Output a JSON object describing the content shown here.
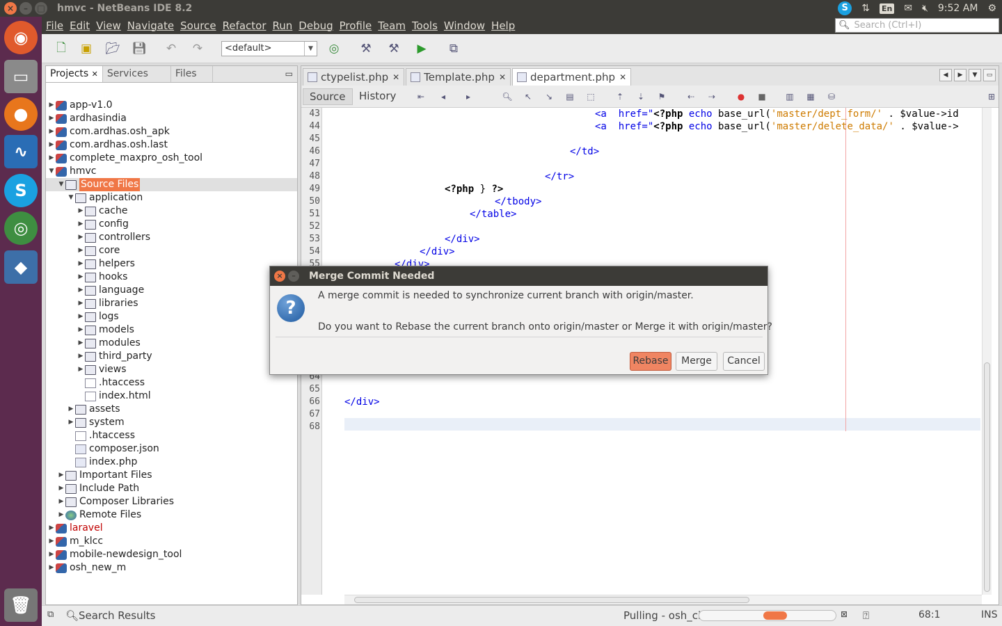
{
  "window": {
    "title": "hmvc - NetBeans IDE 8.2"
  },
  "tray": {
    "skype": "S",
    "lang": "En",
    "time": "9:52 AM"
  },
  "menu": [
    "File",
    "Edit",
    "View",
    "Navigate",
    "Source",
    "Refactor",
    "Run",
    "Debug",
    "Profile",
    "Team",
    "Tools",
    "Window",
    "Help"
  ],
  "search": {
    "placeholder": "Search (Ctrl+I)"
  },
  "toolbar": {
    "config": "<default>"
  },
  "panel_tabs": [
    "Projects",
    "Services",
    "Files"
  ],
  "tree": [
    {
      "label": "app-v1.0",
      "level": 0,
      "arrow": "▶",
      "icon": "proj"
    },
    {
      "label": "ardhasindia",
      "level": 0,
      "arrow": "▶",
      "icon": "proj"
    },
    {
      "label": "com.ardhas.osh_apk",
      "level": 0,
      "arrow": "▶",
      "icon": "proj"
    },
    {
      "label": "com.ardhas.osh.last",
      "level": 0,
      "arrow": "▶",
      "icon": "proj"
    },
    {
      "label": "complete_maxpro_osh_tool",
      "level": 0,
      "arrow": "▶",
      "icon": "proj"
    },
    {
      "label": "hmvc",
      "level": 0,
      "arrow": "▼",
      "icon": "proj"
    },
    {
      "label": "Source Files",
      "level": 1,
      "arrow": "▼",
      "icon": "fold",
      "selected": true
    },
    {
      "label": "application",
      "level": 2,
      "arrow": "▼",
      "icon": "fold"
    },
    {
      "label": "cache",
      "level": 3,
      "arrow": "▶",
      "icon": "fold"
    },
    {
      "label": "config",
      "level": 3,
      "arrow": "▶",
      "icon": "fold"
    },
    {
      "label": "controllers",
      "level": 3,
      "arrow": "▶",
      "icon": "fold"
    },
    {
      "label": "core",
      "level": 3,
      "arrow": "▶",
      "icon": "fold"
    },
    {
      "label": "helpers",
      "level": 3,
      "arrow": "▶",
      "icon": "fold"
    },
    {
      "label": "hooks",
      "level": 3,
      "arrow": "▶",
      "icon": "fold"
    },
    {
      "label": "language",
      "level": 3,
      "arrow": "▶",
      "icon": "fold"
    },
    {
      "label": "libraries",
      "level": 3,
      "arrow": "▶",
      "icon": "fold"
    },
    {
      "label": "logs",
      "level": 3,
      "arrow": "▶",
      "icon": "fold"
    },
    {
      "label": "models",
      "level": 3,
      "arrow": "▶",
      "icon": "fold"
    },
    {
      "label": "modules",
      "level": 3,
      "arrow": "▶",
      "icon": "fold"
    },
    {
      "label": "third_party",
      "level": 3,
      "arrow": "▶",
      "icon": "fold"
    },
    {
      "label": "views",
      "level": 3,
      "arrow": "▶",
      "icon": "fold"
    },
    {
      "label": ".htaccess",
      "level": 3,
      "arrow": "",
      "icon": "file"
    },
    {
      "label": "index.html",
      "level": 3,
      "arrow": "",
      "icon": "file"
    },
    {
      "label": "assets",
      "level": 2,
      "arrow": "▶",
      "icon": "fold"
    },
    {
      "label": "system",
      "level": 2,
      "arrow": "▶",
      "icon": "fold"
    },
    {
      "label": ".htaccess",
      "level": 2,
      "arrow": "",
      "icon": "file"
    },
    {
      "label": "composer.json",
      "level": 2,
      "arrow": "",
      "icon": "php"
    },
    {
      "label": "index.php",
      "level": 2,
      "arrow": "",
      "icon": "php"
    },
    {
      "label": "Important Files",
      "level": 1,
      "arrow": "▶",
      "icon": "fold"
    },
    {
      "label": "Include Path",
      "level": 1,
      "arrow": "▶",
      "icon": "fold"
    },
    {
      "label": "Composer Libraries",
      "level": 1,
      "arrow": "▶",
      "icon": "fold"
    },
    {
      "label": "Remote Files",
      "level": 1,
      "arrow": "▶",
      "icon": "globe"
    },
    {
      "label": "laravel",
      "level": 0,
      "arrow": "▶",
      "icon": "proj",
      "color": "#c00000"
    },
    {
      "label": "m_klcc",
      "level": 0,
      "arrow": "▶",
      "icon": "proj"
    },
    {
      "label": "mobile-newdesign_tool",
      "level": 0,
      "arrow": "▶",
      "icon": "proj"
    },
    {
      "label": "osh_new_m",
      "level": 0,
      "arrow": "▶",
      "icon": "proj"
    }
  ],
  "editor_tabs": [
    {
      "label": "ctypelist.php",
      "active": false
    },
    {
      "label": "Template.php",
      "active": false
    },
    {
      "label": "department.php",
      "active": true
    }
  ],
  "editor_toolbar": {
    "source": "Source",
    "history": "History"
  },
  "line_numbers": [
    "43",
    "44",
    "45",
    "46",
    "47",
    "48",
    "49",
    "50",
    "51",
    "52",
    "53",
    "54",
    "55",
    "64",
    "65",
    "66",
    "67",
    "68"
  ],
  "code_lines": [
    {
      "n": "43",
      "segs": [
        [
          "tag",
          "<a"
        ],
        [
          "tag",
          "  href=\""
        ],
        [
          "kw",
          "<?php"
        ],
        [
          "tag",
          " echo"
        ],
        [
          "fn",
          " base_url("
        ],
        [
          "str",
          "'master/dept_form/'"
        ],
        [
          "fn",
          " . $value->id"
        ]
      ]
    },
    {
      "n": "44",
      "segs": [
        [
          "tag",
          "<a"
        ],
        [
          "tag",
          "  href=\""
        ],
        [
          "kw",
          "<?php"
        ],
        [
          "tag",
          " echo"
        ],
        [
          "fn",
          " base_url("
        ],
        [
          "str",
          "'master/delete_data/'"
        ],
        [
          "fn",
          " . $value->"
        ]
      ]
    },
    {
      "n": "45",
      "segs": []
    },
    {
      "n": "46",
      "segs": [
        [
          "tag",
          "</td>"
        ]
      ]
    },
    {
      "n": "47",
      "segs": []
    },
    {
      "n": "48",
      "segs": [
        [
          "tag",
          "</tr>"
        ]
      ]
    },
    {
      "n": "49",
      "segs": [
        [
          "kw",
          "<?php"
        ],
        [
          "fn",
          " } "
        ],
        [
          "kw",
          "?>"
        ]
      ]
    },
    {
      "n": "50",
      "segs": [
        [
          "tag",
          "</tbody>"
        ]
      ]
    },
    {
      "n": "51",
      "segs": [
        [
          "tag",
          "</table>"
        ]
      ]
    },
    {
      "n": "52",
      "segs": []
    },
    {
      "n": "53",
      "segs": [
        [
          "tag",
          "</div>"
        ]
      ]
    },
    {
      "n": "54",
      "segs": [
        [
          "tag",
          "</div>"
        ]
      ]
    },
    {
      "n": "55",
      "segs": [
        [
          "tag",
          "</div>"
        ]
      ]
    },
    {
      "n": "66",
      "segs": [
        [
          "tag",
          "</div>"
        ]
      ]
    }
  ],
  "dialog": {
    "title": "Merge Commit Needed",
    "line1": "A merge commit is needed to synchronize current branch with origin/master.",
    "line2": "Do you want to Rebase the current branch onto origin/master or Merge it with origin/master?",
    "rebase": "Rebase",
    "merge": "Merge",
    "cancel": "Cancel"
  },
  "status": {
    "search_results": "Search Results",
    "task": "Pulling - osh_ci",
    "position": "68:1",
    "mode": "INS"
  },
  "colors": {
    "accent": "#f07746",
    "launcher": "#5c2b4e",
    "titlebar": "#3c3b37"
  }
}
